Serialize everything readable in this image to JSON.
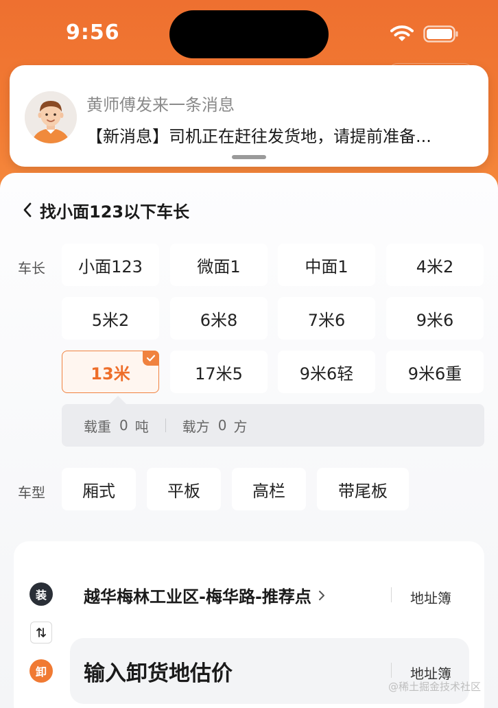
{
  "status_bar": {
    "time": "9:56"
  },
  "notification": {
    "title": "黄师傅发来一条消息",
    "message": "【新消息】司机正在赶往发货地，请提前准备..."
  },
  "nav": {
    "title": "找小面123以下车长"
  },
  "vehicle_length": {
    "label": "车长",
    "options": [
      "小面123",
      "微面1",
      "中面1",
      "4米2",
      "5米2",
      "6米8",
      "7米6",
      "9米6",
      "13米",
      "17米5",
      "9米6轻",
      "9米6重"
    ],
    "selected": "13米"
  },
  "capacity": {
    "weight_label": "载重",
    "weight_value": "0",
    "weight_unit": "吨",
    "volume_label": "载方",
    "volume_value": "0",
    "volume_unit": "方"
  },
  "vehicle_type": {
    "label": "车型",
    "options": [
      "厢式",
      "平板",
      "高栏",
      "带尾板"
    ]
  },
  "address": {
    "load_badge": "装",
    "load_address": "越华梅林工业区-梅华路-推荐点",
    "address_book": "地址簿",
    "unload_badge": "卸",
    "unload_placeholder": "输入卸货地估价"
  },
  "watermark": "@稀土掘金技术社区",
  "colors": {
    "accent": "#f0823f",
    "load_badge": "#2a2f37",
    "unload_badge": "#f07a33"
  }
}
